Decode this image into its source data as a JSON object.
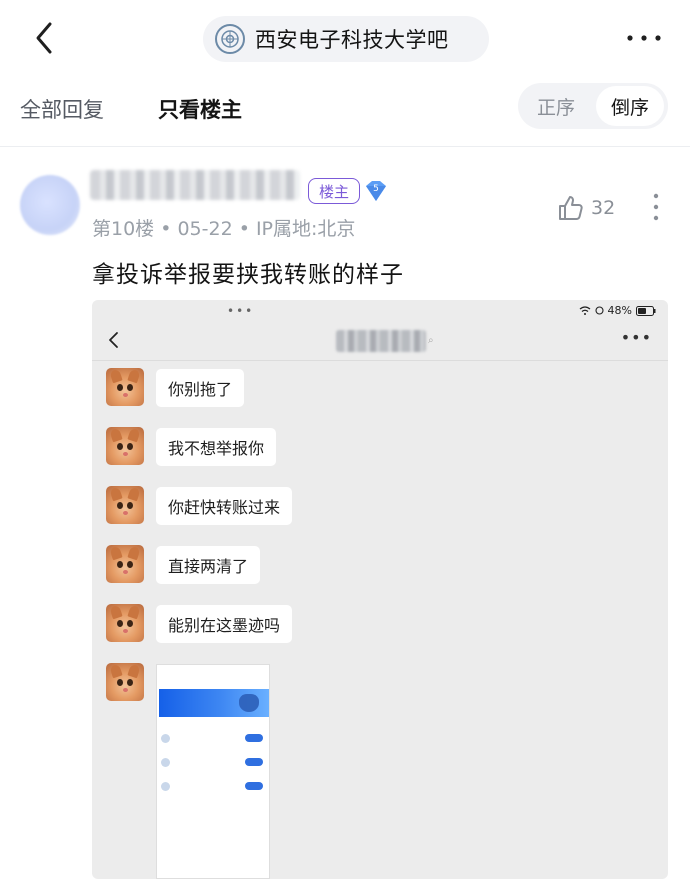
{
  "topbar": {
    "forum_name": "西安电子科技大学吧"
  },
  "filter": {
    "tab_all": "全部回复",
    "tab_op": "只看楼主",
    "order_asc": "正序",
    "order_desc": "倒序"
  },
  "post": {
    "op_badge": "楼主",
    "level": "5",
    "meta": "第10楼 • 05-22 • IP属地:北京",
    "likes": "32",
    "text": "拿投诉举报要挟我转账的样子"
  },
  "embed": {
    "status_right": "48%",
    "messages": [
      "你别拖了",
      "我不想举报你",
      "你赶快转账过来",
      "直接两清了",
      "能别在这墨迹吗"
    ]
  },
  "colors": {
    "accent_purple": "#7b5ad8",
    "level_blue": "#5b9df5",
    "mini_banner_blue": "#1560e8"
  }
}
